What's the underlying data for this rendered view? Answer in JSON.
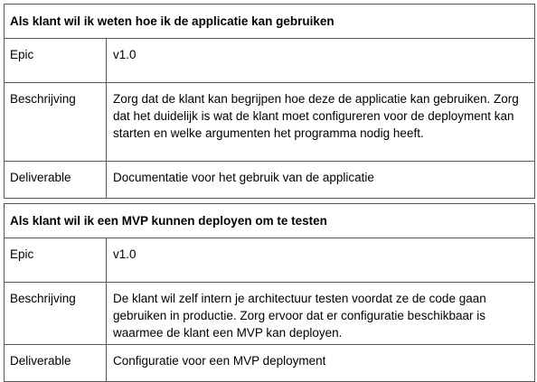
{
  "stories": [
    {
      "title": "Als klant wil ik weten hoe ik de applicatie kan gebruiken",
      "epic_label": "Epic",
      "epic_value": "v1.0",
      "description_label": "Beschrijving",
      "description_value": "Zorg dat de klant kan begrijpen hoe deze de applicatie kan gebruiken. Zorg dat het duidelijk is wat de klant moet configureren voor de deployment kan starten en welke argumenten het programma nodig heeft.",
      "deliverable_label": "Deliverable",
      "deliverable_value": "Documentatie voor het gebruik van de applicatie"
    },
    {
      "title": "Als klant wil ik een MVP kunnen deployen om te testen",
      "epic_label": "Epic",
      "epic_value": "v1.0",
      "description_label": "Beschrijving",
      "description_value": "De klant wil zelf intern je architectuur testen voordat ze de code gaan gebruiken in productie. Zorg ervoor dat er configuratie beschikbaar is waarmee de klant een MVP kan deployen.",
      "deliverable_label": "Deliverable",
      "deliverable_value": "Configuratie voor een MVP deployment"
    }
  ]
}
